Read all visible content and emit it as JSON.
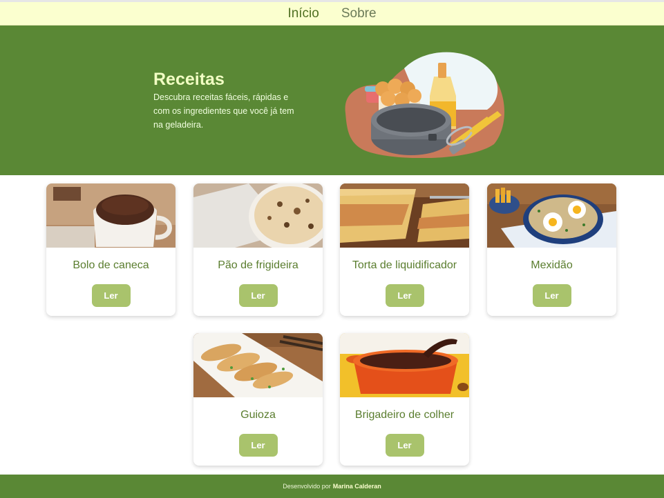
{
  "nav": {
    "items": [
      {
        "label": "Início"
      },
      {
        "label": "Sobre"
      }
    ]
  },
  "hero": {
    "title": "Receitas",
    "description": "Descubra receitas fáceis, rápidas e com os ingredientes que você já tem na geladeira."
  },
  "recipes": [
    {
      "title": "Bolo de caneca",
      "button": "Ler"
    },
    {
      "title": "Pão de frigideira",
      "button": "Ler"
    },
    {
      "title": "Torta de liquidificador",
      "button": "Ler"
    },
    {
      "title": "Mexidão",
      "button": "Ler"
    },
    {
      "title": "Guioza",
      "button": "Ler"
    },
    {
      "title": "Brigadeiro de colher",
      "button": "Ler"
    }
  ],
  "footer": {
    "prefix": "Desenvolvido por",
    "author": "Marina Calderan"
  },
  "colors": {
    "brand_green": "#5a8835",
    "nav_bg": "#fbffcf",
    "button": "#a9c36c",
    "card_title": "#5a7d2e"
  }
}
